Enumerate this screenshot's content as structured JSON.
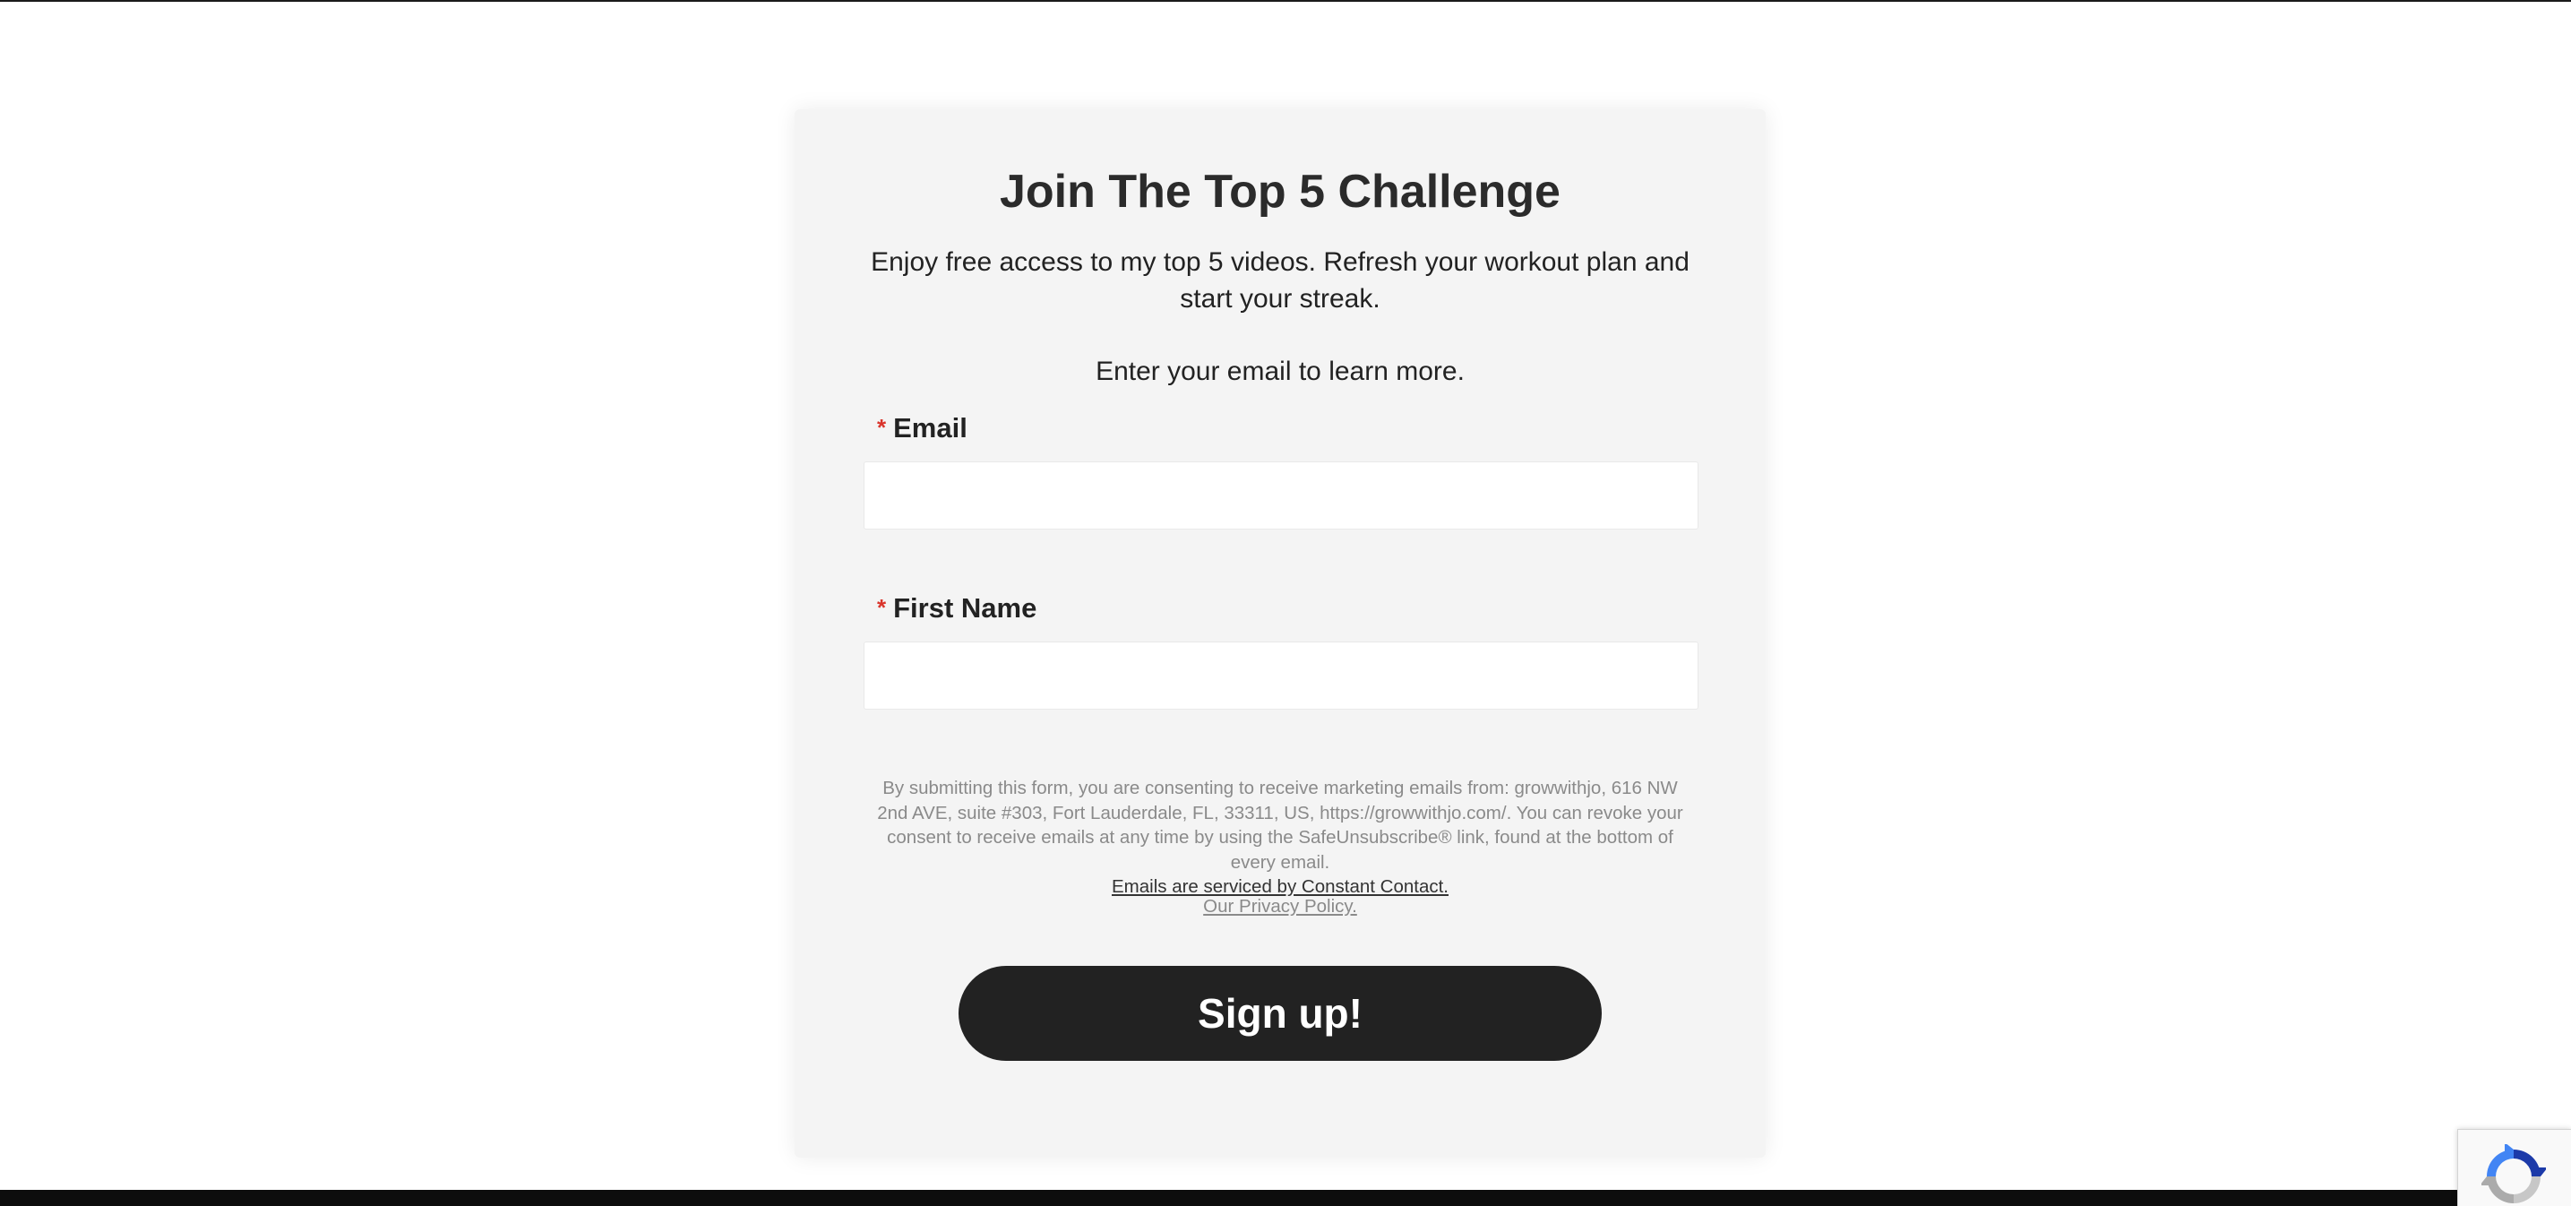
{
  "form": {
    "title": "Join The Top 5 Challenge",
    "intro": "Enjoy free access to my top 5 videos. Refresh your workout plan and start your streak.",
    "prompt": "Enter your email to learn more.",
    "required_marker": "*",
    "email": {
      "label": "Email",
      "value": "",
      "placeholder": ""
    },
    "first_name": {
      "label": "First Name",
      "value": "",
      "placeholder": ""
    },
    "consent_text": "By submitting this form, you are consenting to receive marketing emails from: growwithjo, 616 NW 2nd AVE, suite #303, Fort Lauderdale, FL, 33311, US, https://growwithjo.com/. You can revoke your consent to receive emails at any time by using the SafeUnsubscribe® link, found at the bottom of every email.",
    "service_link": "Emails are serviced by Constant Contact.",
    "privacy_link": "Our Privacy Policy.",
    "submit_label": "Sign up!"
  },
  "recaptcha": {
    "icon": "recaptcha-icon"
  },
  "colors": {
    "card_background": "#f4f4f4",
    "button_background": "#222222",
    "required_marker": "#d9342b",
    "muted_text": "#8a8a8a"
  }
}
